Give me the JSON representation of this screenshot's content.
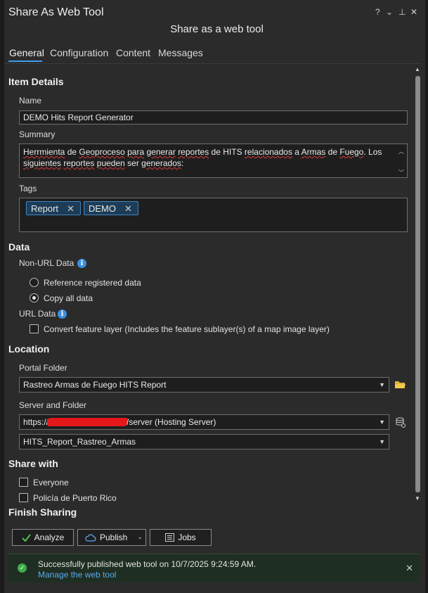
{
  "window": {
    "title": "Share As Web Tool",
    "controls": {
      "help": "?",
      "menu": "⌄",
      "pin": "⊥",
      "close": "✕"
    }
  },
  "header": {
    "subtitle": "Share as a web tool"
  },
  "tabs": [
    {
      "label": "General",
      "active": true
    },
    {
      "label": "Configuration",
      "active": false
    },
    {
      "label": "Content",
      "active": false
    },
    {
      "label": "Messages",
      "active": false
    }
  ],
  "item_details": {
    "heading": "Item Details",
    "name_label": "Name",
    "name_value": "DEMO Hits Report Generator",
    "summary_label": "Summary",
    "summary": {
      "w1": "Herrmienta",
      "t1": " de ",
      "w2": "Geoproceso",
      "t2": " ",
      "w3": "para",
      "t3": " ",
      "w4": "generar",
      "t4": " ",
      "w5": "reportes",
      "t5": " de HITS ",
      "w6": "relacionados",
      "t6": " a ",
      "w7": "Armas",
      "t7": " de ",
      "w8": "Fuego",
      "t8": ". Los ",
      "w9": "siguientes",
      "t9": " ",
      "w10": "reportes",
      "t10": " ",
      "w11": "pueden",
      "t11": " ser ",
      "w12": "generados",
      "t12": ":"
    },
    "tags_label": "Tags",
    "tags": [
      "Report",
      "DEMO"
    ]
  },
  "data": {
    "heading": "Data",
    "non_url_label": "Non-URL Data",
    "options": [
      {
        "label": "Reference registered data",
        "selected": false
      },
      {
        "label": "Copy all data",
        "selected": true
      }
    ],
    "url_label": "URL Data",
    "convert_label": "Convert feature layer (Includes the feature sublayer(s) of a map image layer)"
  },
  "location": {
    "heading": "Location",
    "portal_folder_label": "Portal Folder",
    "portal_folder_value": "Rastreo Armas de Fuego HITS Report",
    "server_label": "Server and Folder",
    "server_prefix": "https://",
    "server_suffix": "/server (Hosting Server)",
    "server_folder_value": "HITS_Report_Rastreo_Armas"
  },
  "share_with": {
    "heading": "Share with",
    "options": [
      {
        "label": "Everyone",
        "checked": false
      },
      {
        "label": "Policía de Puerto Rico",
        "checked": false
      }
    ]
  },
  "finish": {
    "heading": "Finish Sharing",
    "analyze_label": "Analyze",
    "publish_label": "Publish",
    "jobs_label": "Jobs"
  },
  "banner": {
    "message": "Successfully published web tool on 10/7/2025 9:24:59 AM.",
    "link": "Manage the web tool"
  },
  "colors": {
    "accent": "#3d9be9",
    "success": "#3fae4a",
    "chip": "#1d3c57"
  }
}
